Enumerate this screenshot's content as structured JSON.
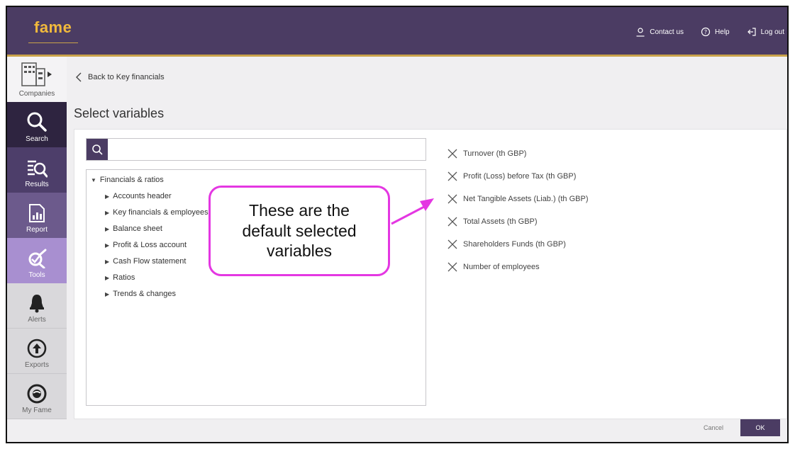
{
  "header": {
    "logo": "fame",
    "nav": [
      {
        "label": "Contact us",
        "icon": "user-icon"
      },
      {
        "label": "Help",
        "icon": "help-icon"
      },
      {
        "label": "Log out",
        "icon": "logout-icon"
      }
    ]
  },
  "sidebar": {
    "items": [
      {
        "label": "Companies",
        "icon": "building-icon"
      },
      {
        "label": "Search",
        "icon": "search-icon"
      },
      {
        "label": "Results",
        "icon": "results-icon"
      },
      {
        "label": "Report",
        "icon": "report-icon"
      },
      {
        "label": "Tools",
        "icon": "tools-icon"
      },
      {
        "label": "Alerts",
        "icon": "bell-icon"
      },
      {
        "label": "Exports",
        "icon": "export-icon"
      },
      {
        "label": "My Fame",
        "icon": "my-fame-icon"
      }
    ]
  },
  "main": {
    "back_label": "Back to Key financials",
    "title": "Select variables",
    "search_placeholder": "",
    "tree": {
      "root": "Financials & ratios",
      "children": [
        "Accounts header",
        "Key financials & employees",
        "Balance sheet",
        "Profit & Loss account",
        "Cash Flow statement",
        "Ratios",
        "Trends & changes"
      ]
    },
    "selected": [
      "Turnover (th GBP)",
      "Profit (Loss) before Tax (th GBP)",
      "Net Tangible Assets (Liab.) (th GBP)",
      "Total Assets (th GBP)",
      "Shareholders Funds (th GBP)",
      "Number of employees"
    ],
    "cancel_label": "Cancel",
    "ok_label": "OK"
  },
  "callout": {
    "lines": [
      "These are the",
      "default selected",
      "variables"
    ],
    "color": "#e437e2"
  },
  "colors": {
    "header_bg": "#4b3c63",
    "logo": "#f1b93c",
    "accent": "#c9a24a"
  }
}
